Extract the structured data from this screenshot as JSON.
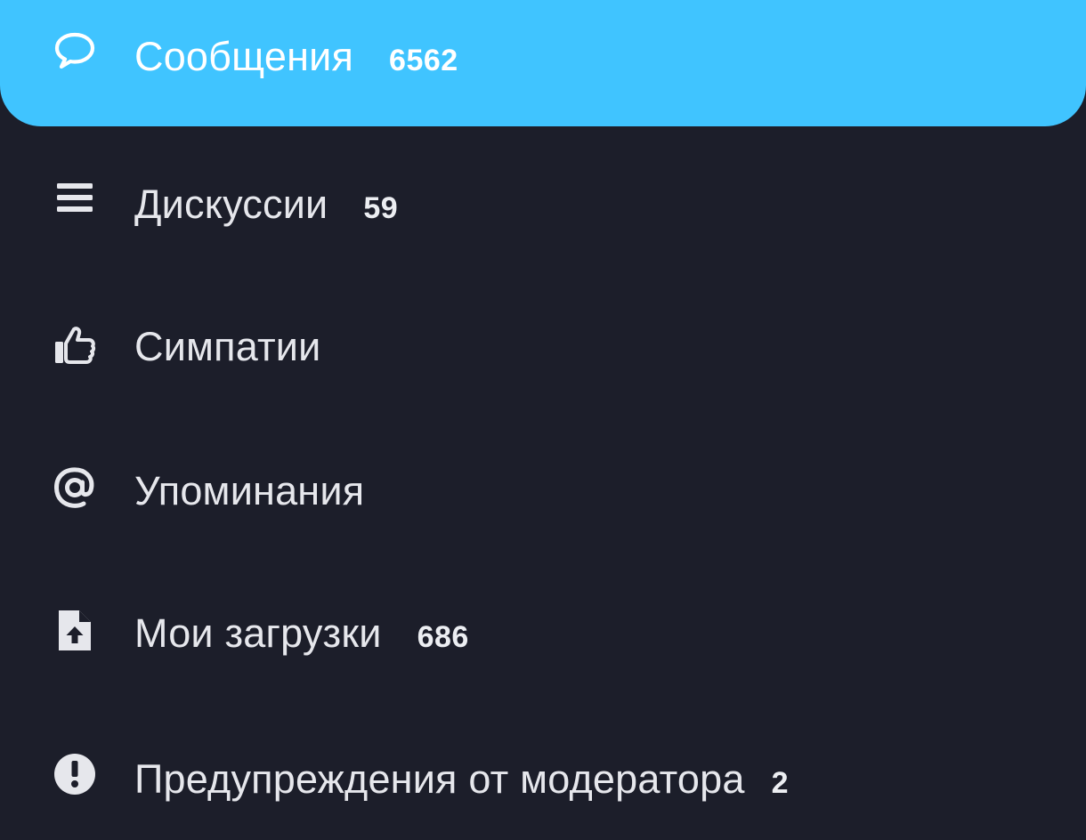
{
  "colors": {
    "background": "#1c1e2a",
    "active_background": "#40c4ff",
    "text": "#e6e7ec"
  },
  "menu": {
    "items": [
      {
        "label": "Сообщения",
        "count": "6562",
        "icon": "chat-bubble-icon",
        "active": true
      },
      {
        "label": "Дискуссии",
        "count": "59",
        "icon": "list-icon",
        "active": false
      },
      {
        "label": "Симпатии",
        "count": "",
        "icon": "thumbs-up-icon",
        "active": false
      },
      {
        "label": "Упоминания",
        "count": "",
        "icon": "at-sign-icon",
        "active": false
      },
      {
        "label": "Мои загрузки",
        "count": "686",
        "icon": "file-upload-icon",
        "active": false
      },
      {
        "label": "Предупреждения от модератора",
        "count": "2",
        "icon": "exclamation-circle-icon",
        "active": false
      }
    ]
  }
}
